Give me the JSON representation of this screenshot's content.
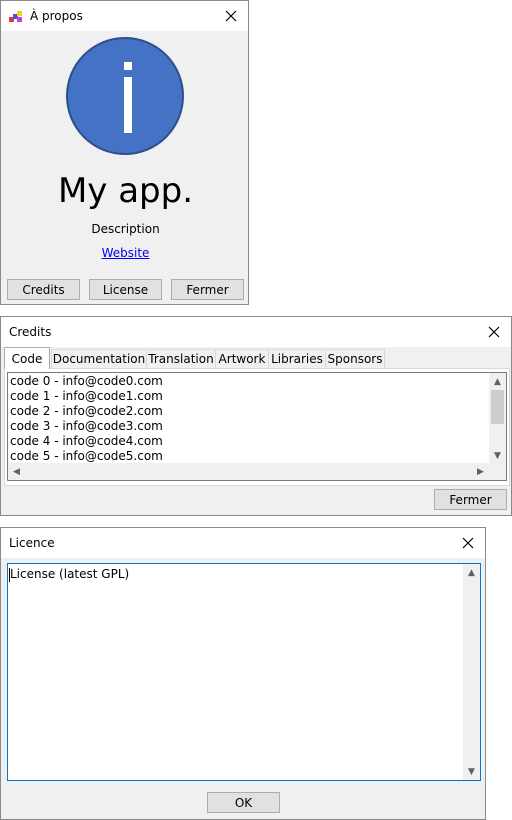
{
  "about": {
    "title": "À propos",
    "app_name": "My app.",
    "description": "Description",
    "website_link": "Website",
    "buttons": {
      "credits": "Credits",
      "license": "License",
      "close": "Fermer"
    }
  },
  "credits": {
    "title": "Credits",
    "tabs": [
      "Code",
      "Documentation",
      "Translation",
      "Artwork",
      "Libraries",
      "Sponsors"
    ],
    "active_tab": "Code",
    "lines": [
      "code 0 - info@code0.com",
      "code 1 - info@code1.com",
      "code 2 - info@code2.com",
      "code 3 - info@code3.com",
      "code 4 - info@code4.com",
      "code 5 - info@code5.com"
    ],
    "close_button": "Fermer"
  },
  "licence": {
    "title": "Licence",
    "text": "License (latest GPL)",
    "ok_button": "OK"
  },
  "colors": {
    "info_circle_fill": "#4472c4",
    "info_circle_stroke": "#2f4f8a",
    "link": "#0000ee",
    "focus_border": "#0078d7"
  },
  "icons": {
    "about_titlebar": "app-logo-icon",
    "close": "close-icon",
    "info": "info-icon",
    "scroll_up": "scroll-up-arrow-icon",
    "scroll_down": "scroll-down-arrow-icon",
    "scroll_left": "scroll-left-arrow-icon",
    "scroll_right": "scroll-right-arrow-icon"
  }
}
